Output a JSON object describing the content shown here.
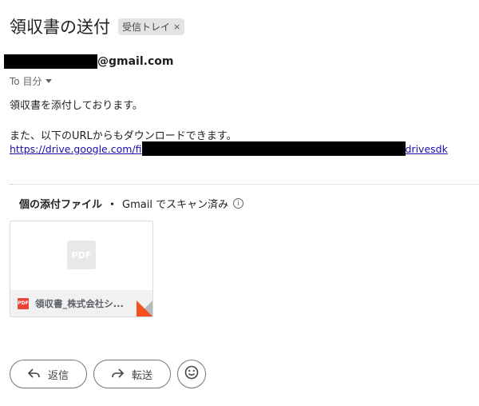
{
  "email": {
    "subject": "領収書の送付",
    "label_chip": "受信トレイ",
    "label_close": "×",
    "sender_domain": "@gmail.com",
    "to_line": "To 目分",
    "body_line1": "領収書を添付しております。",
    "body_line2": "また、以下のURLからもダウンロードできます。",
    "link_prefix": "https://drive.google.com/fi",
    "link_suffix": "drivesdk"
  },
  "attachments": {
    "header_title": "個の添付ファイル",
    "header_dot": "・",
    "scan_text": "Gmail でスキャン済み",
    "info_glyph": "i",
    "file": {
      "preview_label": "PDF",
      "small_label": "PDF",
      "name": "領収書_株式会社シ..."
    }
  },
  "actions": {
    "reply_label": "返信",
    "forward_label": "転送",
    "reply_icon": "reply-icon",
    "forward_icon": "forward-icon",
    "emoji_icon": "emoji-icon"
  }
}
